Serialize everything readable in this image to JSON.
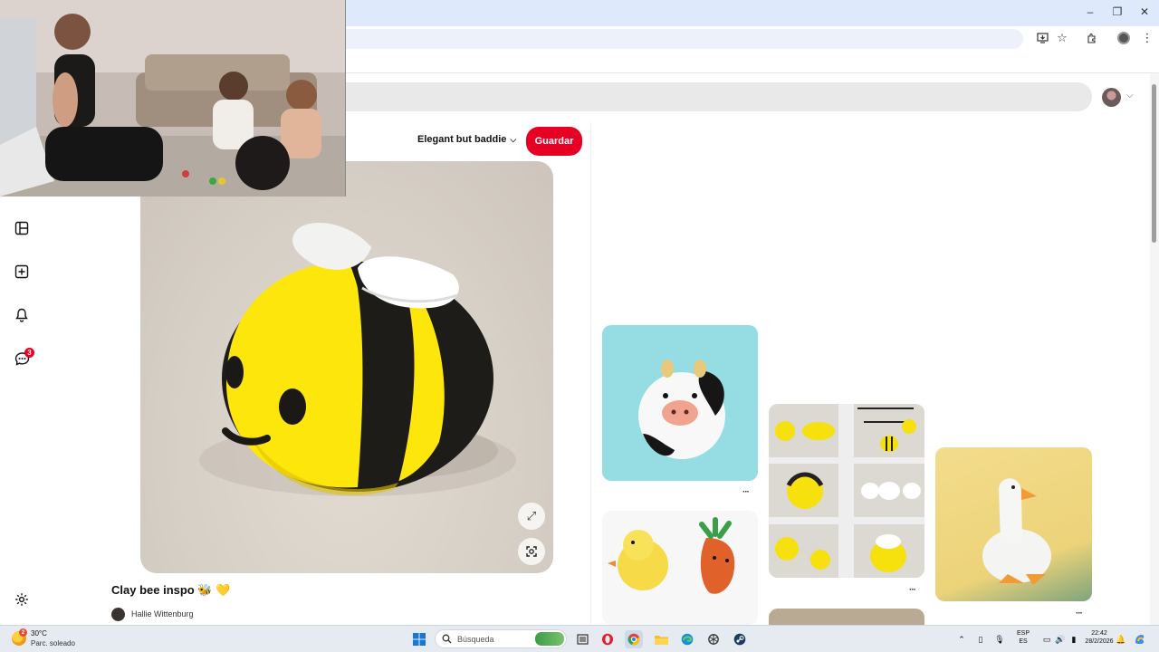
{
  "browser": {
    "window_controls": [
      "minimize",
      "maximize",
      "close"
    ],
    "toolbar_icons": [
      "install-app-icon",
      "bookmark-star-icon",
      "extensions-icon",
      "profile-icon",
      "kebab-menu-icon"
    ]
  },
  "pin": {
    "board_name": "Elegant but baddie",
    "save_label": "Guardar",
    "title": "Clay bee inspo 🐝 💛",
    "creator": "Hallie Wittenburg"
  },
  "sidebar": {
    "items": [
      {
        "icon": "boards-icon"
      },
      {
        "icon": "create-icon"
      },
      {
        "icon": "notifications-bell-icon"
      },
      {
        "icon": "messages-icon",
        "badge": "3"
      },
      {
        "icon": "settings-gear-icon"
      }
    ]
  },
  "related": {
    "more_label": "···"
  },
  "taskbar": {
    "weather_badge": "2",
    "temperature": "30°C",
    "weather_desc": "Parc. soleado",
    "search_placeholder": "Búsqueda",
    "lang_line1": "ESP",
    "lang_line2": "ES",
    "time": "22:42",
    "date": "28/2/2026"
  },
  "colors": {
    "pinterest_red": "#e60023",
    "chrome_titlebar": "#dee9fb",
    "taskbar": "#e6ebf2"
  }
}
